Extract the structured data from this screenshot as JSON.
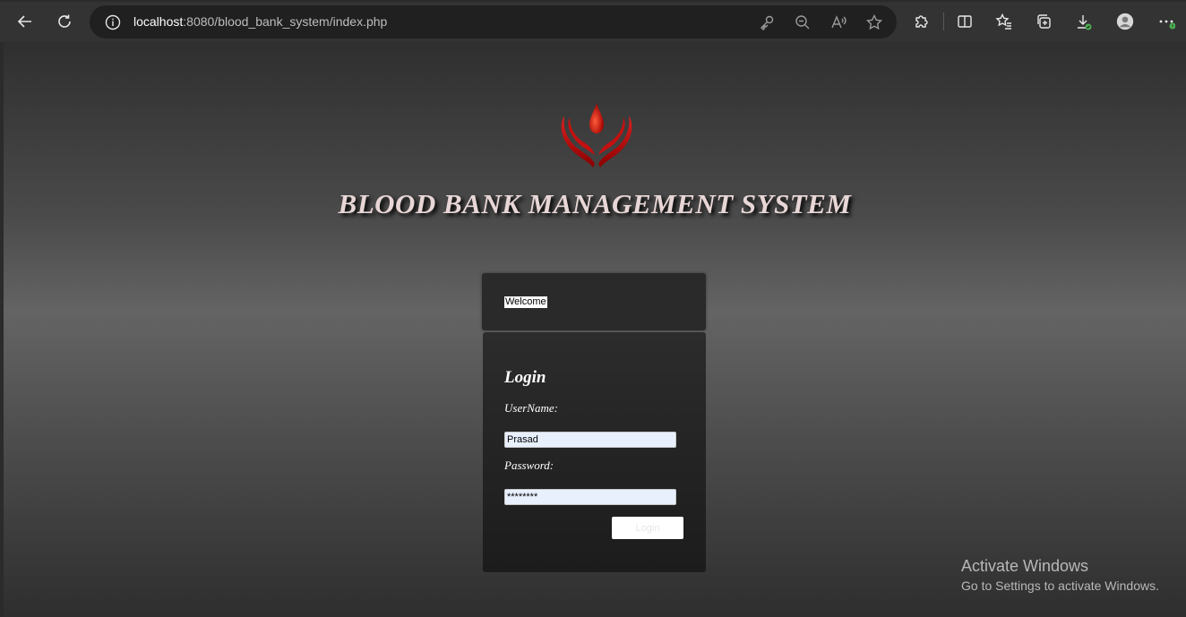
{
  "browser": {
    "url_host": "localhost",
    "url_rest": ":8080/blood_bank_system/index.php"
  },
  "page": {
    "title": "BLOOD BANK MANAGEMENT SYSTEM",
    "welcome_text": "Welcome",
    "login_heading": "Login",
    "username_label": "UserName:",
    "username_value": "Prasad",
    "password_label": "Password:",
    "password_value": "********",
    "login_button": "Login"
  },
  "watermark": {
    "title": "Activate Windows",
    "subtitle": "Go to Settings to activate Windows."
  },
  "colors": {
    "title": "#e8d6d6",
    "logo_red": "#c41010",
    "input_bg": "#e8f0fe"
  },
  "icons": [
    "back-icon",
    "refresh-icon",
    "info-icon",
    "key-icon",
    "zoom-out-icon",
    "read-aloud-icon",
    "favorite-star-icon",
    "extensions-icon",
    "split-screen-icon",
    "favorites-icon",
    "collections-icon",
    "downloads-icon",
    "profile-avatar-icon",
    "more-icon"
  ]
}
